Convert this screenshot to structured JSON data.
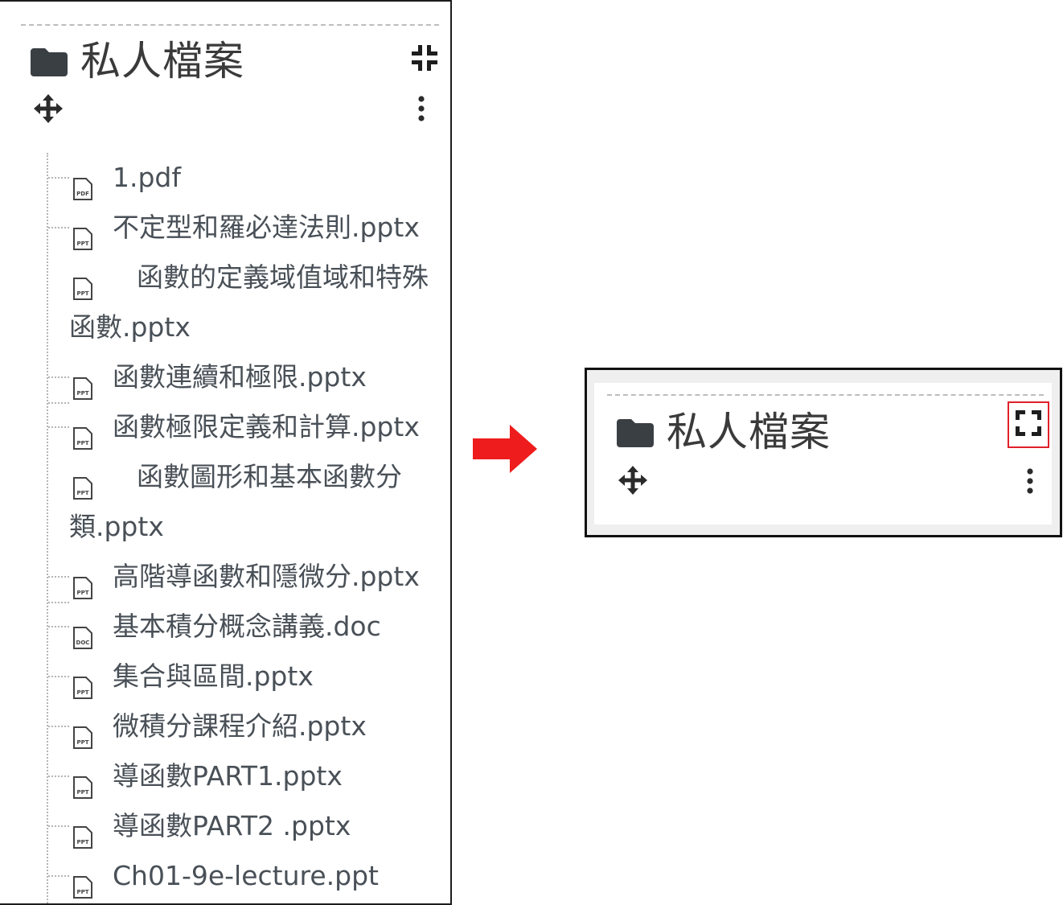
{
  "block": {
    "title": "私人檔案"
  },
  "files": [
    {
      "name": "1.pdf",
      "type": "PDF"
    },
    {
      "name": "不定型和羅必達法則.pptx",
      "type": "PPT"
    },
    {
      "name": "函數的定義域值域和特殊函數.pptx",
      "type": "PPT"
    },
    {
      "name": "函數連續和極限.pptx",
      "type": "PPT"
    },
    {
      "name": "函數極限定義和計算.pptx",
      "type": "PPT"
    },
    {
      "name": "函數圖形和基本函數分類.pptx",
      "type": "PPT"
    },
    {
      "name": "高階導函數和隱微分.pptx",
      "type": "PPT"
    },
    {
      "name": "基本積分概念講義.doc",
      "type": "DOC"
    },
    {
      "name": "集合與區間.pptx",
      "type": "PPT"
    },
    {
      "name": "微積分課程介紹.pptx",
      "type": "PPT"
    },
    {
      "name": "導函數PART1.pptx",
      "type": "PPT"
    },
    {
      "name": "導函數PART2 .pptx",
      "type": "PPT"
    },
    {
      "name": "Ch01-9e-lecture.ppt",
      "type": "PPT"
    }
  ],
  "icons": {
    "folder": "folder-icon",
    "collapse": "compress-icon",
    "expand": "expand-icon",
    "move": "move-icon",
    "menu": "kebab-menu-icon",
    "arrow": "right-arrow-icon"
  },
  "colors": {
    "highlight_border": "#e0202a",
    "arrow": "#ee1c1c",
    "text": "#495057"
  }
}
